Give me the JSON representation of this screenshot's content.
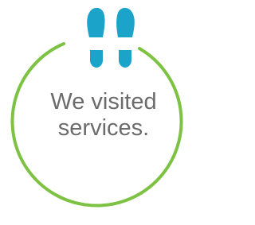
{
  "caption": {
    "line1": "We visited",
    "line2": "services."
  },
  "icon": "footprints-icon",
  "colors": {
    "ring": "#7dc242",
    "footprints": "#1ba3c9",
    "text": "#6b6b6b",
    "background": "#ffffff"
  }
}
